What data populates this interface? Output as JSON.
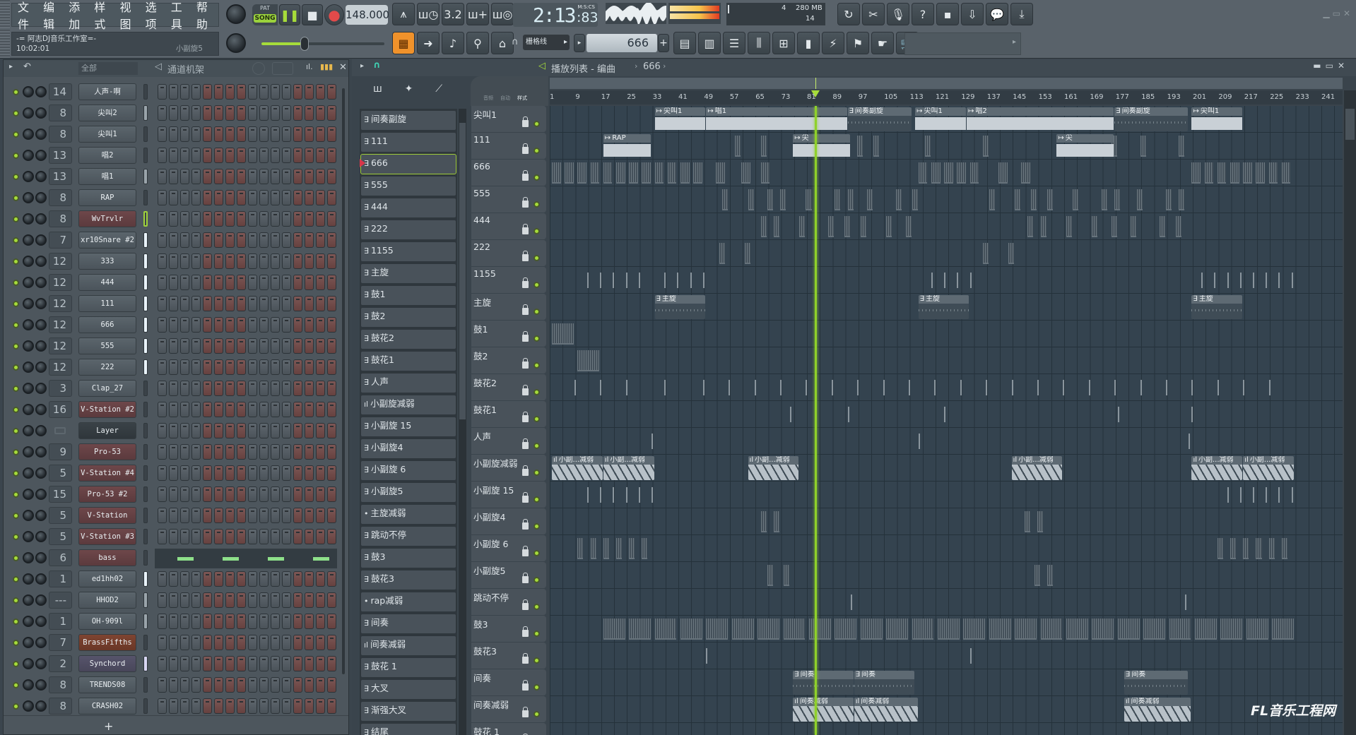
{
  "menu": [
    "文件",
    "编辑",
    "添加",
    "样式",
    "视图",
    "选项",
    "工具",
    "帮助"
  ],
  "hint": {
    "title": "-= 阿志DJ音乐工作室=-",
    "clock": "10:02:01",
    "channel": "小副旋5"
  },
  "transport": {
    "pat": "PAT",
    "song": "SONG",
    "tempo": "148.000",
    "mode": "song",
    "playing": true
  },
  "time": {
    "value": "2:13",
    "centis": ":83",
    "unit": "M:S:CS"
  },
  "cpu": {
    "polyphony": "4",
    "memory": "280 MB",
    "cpu": "14"
  },
  "master_pitch_fraction": 0.35,
  "snap": "栅格线",
  "pattern": "666",
  "toolbar_row1": [
    "metronome",
    "wait-record",
    "countdown",
    "step-edit",
    "loop-record"
  ],
  "toolbar_right": [
    "refresh",
    "scissors",
    "microphone",
    "help",
    "save",
    "export",
    "chat",
    "download"
  ],
  "toolbar_row2": [
    "pattern-song-mode",
    "arrow",
    "pencil",
    "link",
    "typing-keyboard"
  ],
  "toolbar_row2b": [
    "playlist",
    "piano-roll",
    "browser",
    "mixer",
    "channel-rack",
    "plugin-picker",
    "plugin-plug",
    "touch-controller",
    "hand",
    "shop"
  ],
  "colors": {
    "accent": "#9bd23c",
    "step_red": "#7d5755",
    "step_gray": "#5e676e",
    "playhead": "#8fd12a"
  },
  "channel_rack": {
    "filter": "全部",
    "title": "通道机架",
    "add": "+",
    "channels": [
      {
        "name": "人声-啊",
        "mixer": "14",
        "color": "gray",
        "sel": "dim"
      },
      {
        "name": "尖叫2",
        "mixer": "8",
        "color": "gray",
        "sel": "light"
      },
      {
        "name": "尖叫1",
        "mixer": "8",
        "color": "gray",
        "sel": "dim"
      },
      {
        "name": "唱2",
        "mixer": "13",
        "color": "gray",
        "sel": "dim"
      },
      {
        "name": "唱1",
        "mixer": "13",
        "color": "gray",
        "sel": "light"
      },
      {
        "name": "RAP",
        "mixer": "8",
        "color": "gray",
        "sel": "dim"
      },
      {
        "name": "WvTrvlr",
        "mixer": "8",
        "color": "red",
        "sel": "selected"
      },
      {
        "name": "xr10Snare #2",
        "mixer": "7",
        "color": "gray",
        "sel": "bright"
      },
      {
        "name": "333",
        "mixer": "12",
        "color": "gray",
        "sel": "bright"
      },
      {
        "name": "444",
        "mixer": "12",
        "color": "gray",
        "sel": "bright"
      },
      {
        "name": "111",
        "mixer": "12",
        "color": "gray",
        "sel": "bright"
      },
      {
        "name": "666",
        "mixer": "12",
        "color": "gray",
        "sel": "bright"
      },
      {
        "name": "555",
        "mixer": "12",
        "color": "gray",
        "sel": "bright"
      },
      {
        "name": "222",
        "mixer": "12",
        "color": "gray",
        "sel": "bright"
      },
      {
        "name": "Clap_27",
        "mixer": "3",
        "color": "gray",
        "sel": "dim"
      },
      {
        "name": "V-Station #2",
        "mixer": "16",
        "color": "red",
        "sel": "dim"
      },
      {
        "name": "Layer",
        "mixer": "",
        "color": "dark",
        "sel": "dim"
      },
      {
        "name": "Pro-53",
        "mixer": "9",
        "color": "red",
        "sel": "dim"
      },
      {
        "name": "V-Station #4",
        "mixer": "5",
        "color": "red",
        "sel": "dim"
      },
      {
        "name": "Pro-53 #2",
        "mixer": "15",
        "color": "red",
        "sel": "dim"
      },
      {
        "name": "V-Station",
        "mixer": "5",
        "color": "red",
        "sel": "dim"
      },
      {
        "name": "V-Station #3",
        "mixer": "5",
        "color": "red",
        "sel": "dim"
      },
      {
        "name": "bass",
        "mixer": "6",
        "color": "red",
        "sel": "dim",
        "pianoroll": true
      },
      {
        "name": "ed1hh02",
        "mixer": "1",
        "color": "gray",
        "sel": "bright"
      },
      {
        "name": "HHOD2",
        "mixer": "---",
        "color": "gray",
        "sel": "light"
      },
      {
        "name": "OH-909l",
        "mixer": "1",
        "color": "gray",
        "sel": "light"
      },
      {
        "name": "BrassFifths",
        "mixer": "7",
        "color": "brass",
        "sel": "dim"
      },
      {
        "name": "Synchord",
        "mixer": "2",
        "color": "purple",
        "sel": "lavender"
      },
      {
        "name": "TRENDS08",
        "mixer": "8",
        "color": "gray",
        "sel": "dim"
      },
      {
        "name": "CRASH02",
        "mixer": "8",
        "color": "gray",
        "sel": "dim"
      }
    ]
  },
  "playlist": {
    "title": "播放列表 - 编曲",
    "pattern": "666",
    "picker_tabs": [
      "音频",
      "自动",
      "样式"
    ],
    "ruler": [
      1,
      9,
      17,
      25,
      33,
      41,
      49,
      57,
      65,
      73,
      81,
      89,
      97,
      105,
      113,
      121,
      129,
      137,
      145,
      153,
      161,
      169,
      177,
      185,
      193,
      201,
      209,
      217,
      225,
      233,
      241
    ],
    "playhead_bar": 83,
    "patterns": [
      {
        "name": "间奏副旋",
        "icon": "pattern"
      },
      {
        "name": "111",
        "icon": "pattern"
      },
      {
        "name": "666",
        "icon": "pattern",
        "selected": true
      },
      {
        "name": "555",
        "icon": "pattern"
      },
      {
        "name": "444",
        "icon": "pattern"
      },
      {
        "name": "222",
        "icon": "pattern"
      },
      {
        "name": "1155",
        "icon": "pattern"
      },
      {
        "name": "主旋",
        "icon": "pattern"
      },
      {
        "name": "鼓1",
        "icon": "pattern"
      },
      {
        "name": "鼓2",
        "icon": "pattern"
      },
      {
        "name": "鼓花2",
        "icon": "pattern"
      },
      {
        "name": "鼓花1",
        "icon": "pattern"
      },
      {
        "name": "人声",
        "icon": "pattern"
      },
      {
        "name": "小副旋减弱",
        "icon": "automation"
      },
      {
        "name": "小副旋 15",
        "icon": "pattern"
      },
      {
        "name": "小副旋4",
        "icon": "pattern"
      },
      {
        "name": "小副旋 6",
        "icon": "pattern"
      },
      {
        "name": "小副旋5",
        "icon": "pattern"
      },
      {
        "name": "主旋减弱",
        "icon": "dot"
      },
      {
        "name": "跳动不停",
        "icon": "pattern"
      },
      {
        "name": "鼓3",
        "icon": "pattern"
      },
      {
        "name": "鼓花3",
        "icon": "pattern"
      },
      {
        "name": "rap减弱",
        "icon": "dot"
      },
      {
        "name": "间奏",
        "icon": "pattern"
      },
      {
        "name": "间奏减弱",
        "icon": "automation"
      },
      {
        "name": "鼓花 1",
        "icon": "pattern"
      },
      {
        "name": "大叉",
        "icon": "pattern"
      },
      {
        "name": "渐强大叉",
        "icon": "pattern"
      },
      {
        "name": "结尾",
        "icon": "pattern"
      }
    ],
    "tracks": [
      {
        "name": "尖叫1",
        "clips": [
          {
            "s": 33,
            "e": 49,
            "t": "audio",
            "label": "尖叫1"
          },
          {
            "s": 49,
            "e": 93,
            "t": "audio",
            "label": "唱1"
          },
          {
            "s": 93,
            "e": 113,
            "t": "pattern",
            "label": "间奏副旋"
          },
          {
            "s": 114,
            "e": 130,
            "t": "audio",
            "label": "尖叫1"
          },
          {
            "s": 130,
            "e": 176,
            "t": "audio",
            "label": "唱2"
          },
          {
            "s": 176,
            "e": 199,
            "t": "pattern",
            "label": "间奏副旋"
          },
          {
            "s": 200,
            "e": 216,
            "t": "audio",
            "label": "尖叫1"
          }
        ]
      },
      {
        "name": "111",
        "clips": [
          {
            "s": 17,
            "e": 32,
            "t": "audio",
            "label": "RAP"
          },
          {
            "s": 76,
            "e": 94,
            "t": "audio",
            "label": "尖"
          },
          {
            "s": 158,
            "e": 176,
            "t": "audio",
            "label": "尖"
          }
        ],
        "blocks": [
          58,
          66,
          96,
          101,
          117,
          135,
          175,
          184,
          196
        ],
        "block_len": 2
      },
      {
        "name": "666",
        "blocks": [
          1,
          5,
          9,
          13,
          17,
          21,
          25,
          29,
          33,
          37,
          41,
          45,
          52,
          60,
          66,
          115,
          119,
          123,
          127,
          131,
          140,
          147,
          200,
          204,
          208,
          212,
          216,
          220,
          224,
          228
        ],
        "block_len": 3
      },
      {
        "name": "555",
        "blocks": [
          54,
          62,
          68,
          72,
          80,
          89,
          93,
          99,
          108,
          113,
          137,
          145,
          150,
          155,
          163,
          172,
          176,
          183,
          192,
          196
        ],
        "block_len": 2
      },
      {
        "name": "444",
        "blocks": [
          66,
          70,
          78,
          87,
          92,
          97,
          105,
          111,
          149,
          153,
          161,
          169,
          175,
          181,
          190,
          195
        ],
        "block_len": 2
      },
      {
        "name": "222",
        "blocks": [
          53,
          61,
          135,
          143
        ],
        "block_len": 2
      },
      {
        "name": "1155",
        "ticks": [
          12,
          16,
          20,
          24,
          28,
          36,
          40,
          44,
          48,
          119,
          123,
          127,
          131,
          203,
          207,
          211,
          215,
          219,
          223,
          227,
          231
        ]
      },
      {
        "name": "主旋",
        "clips": [
          {
            "s": 33,
            "e": 49,
            "t": "pattern",
            "label": "主旋"
          },
          {
            "s": 115,
            "e": 131,
            "t": "pattern",
            "label": "主旋"
          },
          {
            "s": 200,
            "e": 216,
            "t": "pattern",
            "label": "主旋"
          }
        ]
      },
      {
        "name": "鼓1",
        "blocks": [
          1
        ],
        "block_len": 7
      },
      {
        "name": "鼓2",
        "blocks": [
          9
        ],
        "block_len": 7
      },
      {
        "name": "鼓花2",
        "ticks": [
          8,
          16,
          24,
          36,
          48,
          56,
          64,
          72,
          80,
          88,
          96,
          104,
          112,
          120,
          128,
          136,
          144,
          152,
          160,
          168,
          176,
          184,
          192,
          200,
          208,
          216,
          224
        ]
      },
      {
        "name": "鼓花1",
        "ticks": [
          75,
          93,
          123,
          177,
          200
        ]
      },
      {
        "name": "人声",
        "ticks": [
          32,
          115,
          199
        ]
      },
      {
        "name": "小副旋减弱",
        "clips": [
          {
            "s": 1,
            "e": 17,
            "t": "auto",
            "label": "小副...减弱"
          },
          {
            "s": 17,
            "e": 33,
            "t": "auto",
            "label": "小副...减弱"
          },
          {
            "s": 62,
            "e": 78,
            "t": "auto",
            "label": "小副...减弱"
          },
          {
            "s": 144,
            "e": 160,
            "t": "auto",
            "label": "小副...减弱"
          },
          {
            "s": 200,
            "e": 216,
            "t": "auto",
            "label": "小副...减弱"
          },
          {
            "s": 216,
            "e": 232,
            "t": "auto",
            "label": "小副...减弱"
          }
        ]
      },
      {
        "name": "小副旋 15",
        "ticks": [
          12,
          16,
          20,
          24,
          28,
          32,
          211,
          215,
          219,
          223,
          227,
          231
        ]
      },
      {
        "name": "小副旋4",
        "blocks": [
          66,
          70,
          148,
          152
        ],
        "block_len": 2
      },
      {
        "name": "小副旋 6",
        "blocks": [
          9,
          13,
          17,
          21,
          25,
          29,
          208,
          212,
          216,
          220,
          224,
          228
        ],
        "block_len": 2
      },
      {
        "name": "小副旋5",
        "blocks": [
          68,
          73,
          151,
          155
        ],
        "block_len": 2
      },
      {
        "name": "跳动不停",
        "ticks": [
          94,
          198
        ]
      },
      {
        "name": "鼓3",
        "blocks": [
          17,
          25,
          33,
          41,
          49,
          57,
          65,
          73,
          81,
          89,
          97,
          105,
          113,
          121,
          129,
          137,
          145,
          153,
          161,
          169,
          177,
          185,
          193,
          201,
          209,
          217,
          225
        ],
        "block_len": 7
      },
      {
        "name": "鼓花3",
        "ticks": [
          49,
          131
        ]
      },
      {
        "name": "间奏",
        "clips": [
          {
            "s": 76,
            "e": 95,
            "t": "pattern",
            "label": "间奏"
          },
          {
            "s": 95,
            "e": 114,
            "t": "pattern",
            "label": "间奏"
          },
          {
            "s": 179,
            "e": 199,
            "t": "pattern",
            "label": "间奏"
          }
        ]
      },
      {
        "name": "间奏减弱",
        "clips": [
          {
            "s": 76,
            "e": 95,
            "t": "auto",
            "label": "间奏减弱"
          },
          {
            "s": 95,
            "e": 115,
            "t": "auto",
            "label": "间奏减弱"
          },
          {
            "s": 179,
            "e": 200,
            "t": "auto",
            "label": "间奏减弱"
          }
        ]
      },
      {
        "name": "鼓花 1",
        "ticks": []
      }
    ]
  },
  "watermark": "FL音乐工程网"
}
